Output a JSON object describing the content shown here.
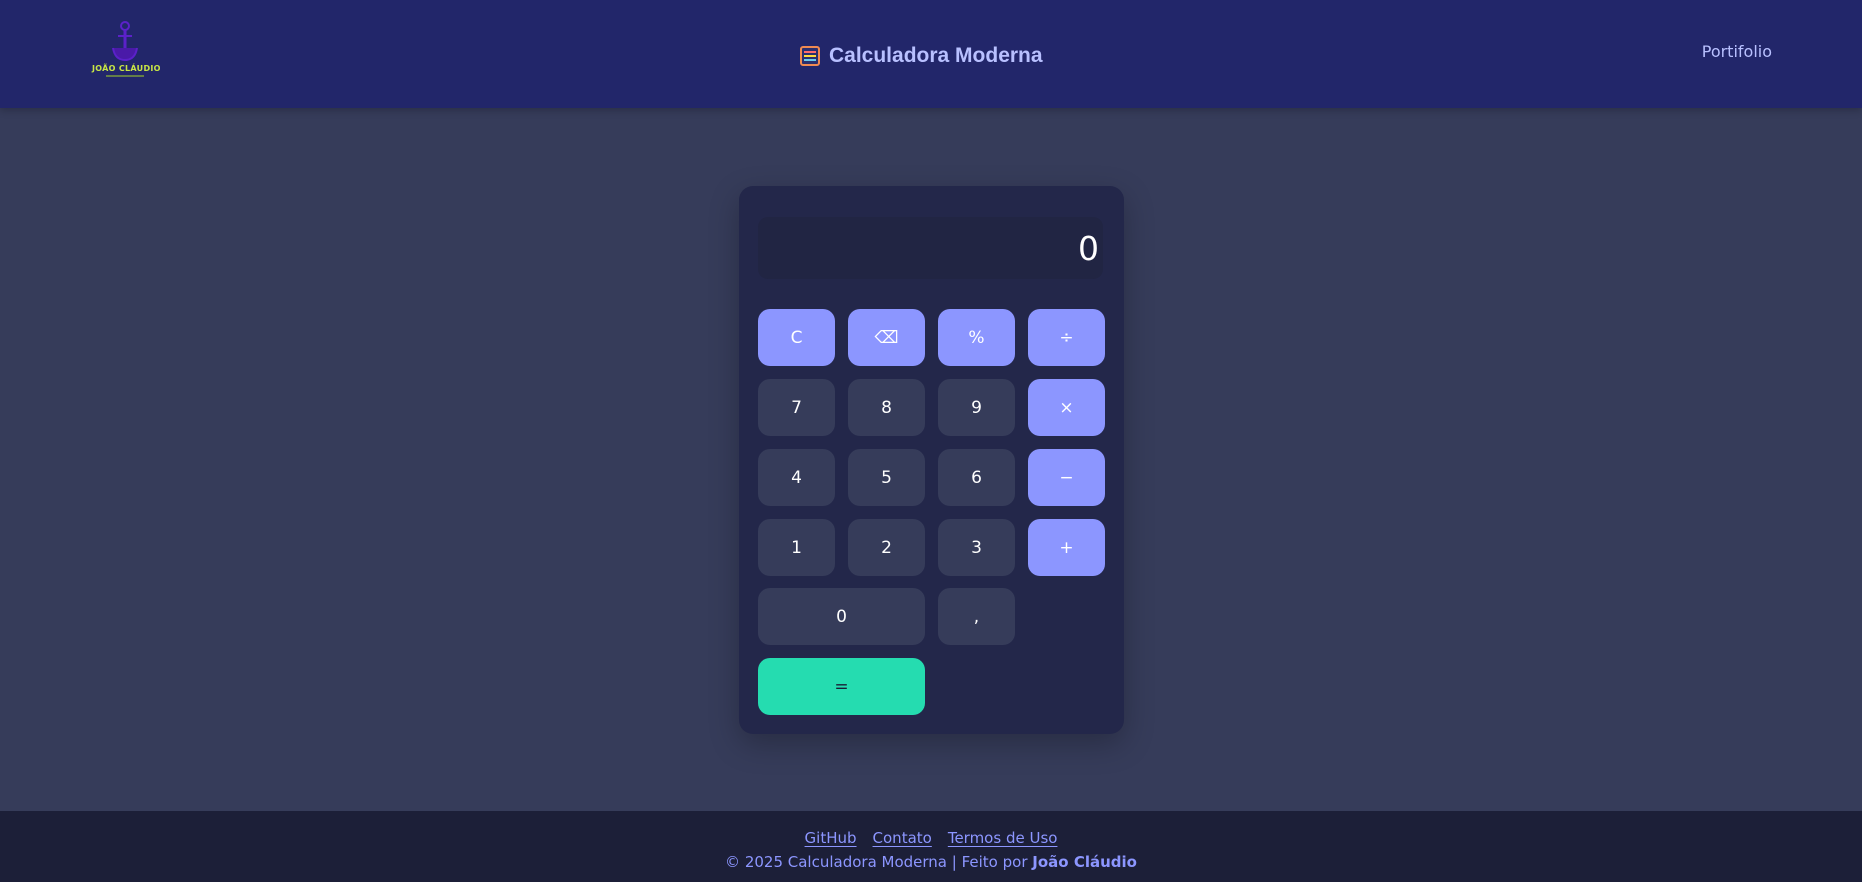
{
  "header": {
    "logo_text": "JOÃO CLÁUDIO",
    "logo_icon": "anchor-icon",
    "brand_icon": "abacus-icon",
    "title": "Calculadora Moderna",
    "nav_portfolio": "Portifolio"
  },
  "calculator": {
    "display_value": "0",
    "rows": [
      [
        {
          "label": "C",
          "kind": "op",
          "name": "clear-button"
        },
        {
          "label": "⌫",
          "kind": "op",
          "name": "backspace-button"
        },
        {
          "label": "%",
          "kind": "op",
          "name": "percent-button"
        },
        {
          "label": "÷",
          "kind": "op",
          "name": "divide-button"
        }
      ],
      [
        {
          "label": "7",
          "kind": "num",
          "name": "digit-7-button"
        },
        {
          "label": "8",
          "kind": "num",
          "name": "digit-8-button"
        },
        {
          "label": "9",
          "kind": "num",
          "name": "digit-9-button"
        },
        {
          "label": "×",
          "kind": "op",
          "name": "multiply-button"
        }
      ],
      [
        {
          "label": "4",
          "kind": "num",
          "name": "digit-4-button"
        },
        {
          "label": "5",
          "kind": "num",
          "name": "digit-5-button"
        },
        {
          "label": "6",
          "kind": "num",
          "name": "digit-6-button"
        },
        {
          "label": "−",
          "kind": "op",
          "name": "subtract-button"
        }
      ],
      [
        {
          "label": "1",
          "kind": "num",
          "name": "digit-1-button"
        },
        {
          "label": "2",
          "kind": "num",
          "name": "digit-2-button"
        },
        {
          "label": "3",
          "kind": "num",
          "name": "digit-3-button"
        },
        {
          "label": "+",
          "kind": "op",
          "name": "add-button"
        }
      ],
      [
        {
          "label": "0",
          "kind": "num",
          "name": "digit-0-button"
        },
        {
          "label": ",",
          "kind": "num",
          "name": "decimal-comma-button"
        }
      ],
      [
        {
          "label": "=",
          "kind": "eq",
          "name": "equals-button"
        }
      ]
    ]
  },
  "footer": {
    "links": [
      "GitHub",
      "Contato",
      "Termos de Uso"
    ],
    "copyright": "© 2025 Calculadora Moderna | Feito por",
    "author": "João Cláudio"
  },
  "colors": {
    "header_bg": "#22266a",
    "page_bg": "#363c5a",
    "calc_bg": "#23274a",
    "operator": "#8c96ff",
    "equals": "#25dcb0",
    "footer_bg": "#1c1f38",
    "accent_text": "#b8c0ff"
  }
}
